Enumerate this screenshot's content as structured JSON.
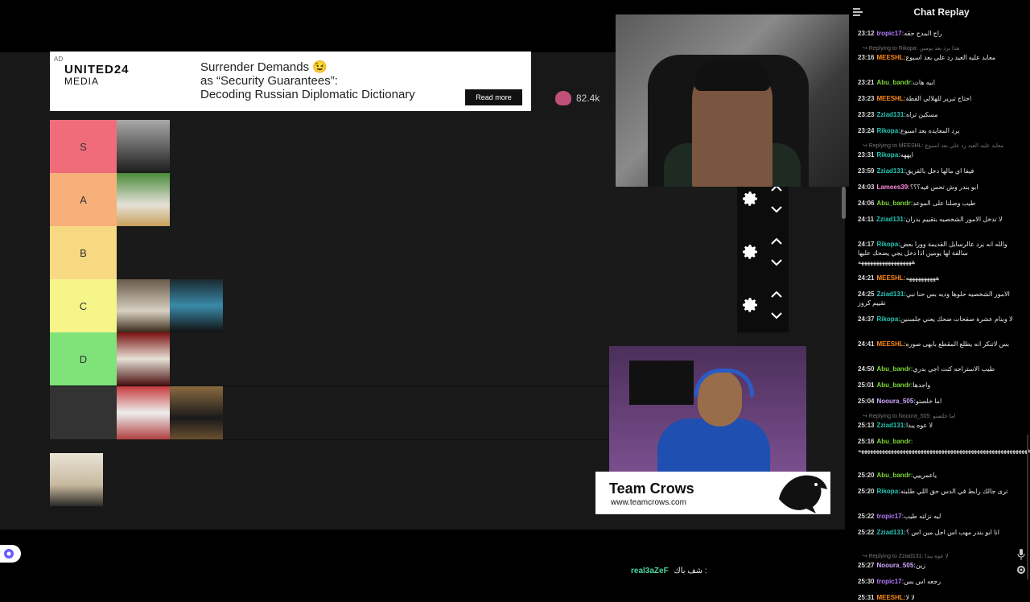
{
  "ad": {
    "tag": "AD",
    "brand_line1": "UNITED24",
    "brand_line2": "MEDIA",
    "headline_l1": "Surrender Demands 😉",
    "headline_l2": "as “Security Guarantees”:",
    "headline_l3": "Decoding Russian Diplomatic Dictionary",
    "cta": "Read more"
  },
  "views": "82.4k",
  "tiers": [
    {
      "label": "S",
      "color": "#f06c7b"
    },
    {
      "label": "A",
      "color": "#f8b07a"
    },
    {
      "label": "B",
      "color": "#f7d983"
    },
    {
      "label": "C",
      "color": "#f6f58a"
    },
    {
      "label": "D",
      "color": "#7fe37a"
    },
    {
      "label": "",
      "color": "#333333"
    }
  ],
  "streamer_banner": {
    "name": "Team Crows",
    "url": "www.teamcrows.com"
  },
  "bottom_chat": {
    "user": "real3aZeF",
    "text": "شف باك :"
  },
  "chat": {
    "title": "Chat Replay",
    "messages": [
      {
        "time": "23:12",
        "user": "tropic17",
        "color": "#b77bff",
        "text": "راح المدح حقه"
      },
      {
        "reply": "Replying to Rikopa: هذا يرد بعد يومين"
      },
      {
        "time": "23:16",
        "user": "MEESHL",
        "color": "#ff8a1a",
        "text": "معايد عليه العيد رد علي بعد اسبوع"
      },
      {
        "time": "23:21",
        "user": "Abu_bandr",
        "color": "#7cd63a",
        "text": "ابيه هات"
      },
      {
        "time": "23:23",
        "user": "MEESHL",
        "color": "#ff8a1a",
        "text": "احتاج تبرير للهلالي القطة"
      },
      {
        "time": "23:23",
        "user": "Zziad131",
        "color": "#27c7b8",
        "text": "مسكين تراه"
      },
      {
        "time": "23:24",
        "user": "Rikopa",
        "color": "#27c7b8",
        "text": "يرد المعايده بعد اسبوع"
      },
      {
        "reply": "Replying to MEESHL: معايد عليه العيد رد علي بعد اسبوع"
      },
      {
        "time": "23:31",
        "user": "Rikopa",
        "color": "#27c7b8",
        "text": "ايههه"
      },
      {
        "time": "23:59",
        "user": "Zziad131",
        "color": "#27c7b8",
        "text": "فيفا اي مالها دخل بالفريق"
      },
      {
        "time": "24:03",
        "user": "Lamees39",
        "color": "#ff8ad8",
        "text": "ابو بندر وش تحس فيه؟؟؟"
      },
      {
        "time": "24:06",
        "user": "Abu_bandr",
        "color": "#7cd63a",
        "text": "طيب وصلنا على الموعد"
      },
      {
        "time": "24:11",
        "user": "Zziad131",
        "color": "#27c7b8",
        "text": "لا تدخل الامور الشخصيه بتقييم بدران"
      },
      {
        "time": "24:17",
        "user": "Rikopa",
        "color": "#27c7b8",
        "text": "والله انه يرد عالرسايل القديمة وورا بعض سالفة لها يومين اذا دخل يجي يضحك عليها ههههههههههههههههههه"
      },
      {
        "time": "24:21",
        "user": "MEESHL",
        "color": "#ff8a1a",
        "text": "ههههههههههه"
      },
      {
        "time": "24:25",
        "user": "Zziad131",
        "color": "#27c7b8",
        "text": "الامور الشخصيه حلوها وديه بس حنا نبي تقييم كروز"
      },
      {
        "time": "24:37",
        "user": "Rikopa",
        "color": "#27c7b8",
        "text": "لا وبنام عشرة صفحات ضحك يعني جلسنين"
      },
      {
        "time": "24:41",
        "user": "MEESHL",
        "color": "#ff8a1a",
        "text": "بس لاتنكر انه يطلع المقطع بابهى صوره"
      },
      {
        "time": "24:50",
        "user": "Abu_bandr",
        "color": "#7cd63a",
        "text": "طيب الاستراحه كنت اجي بدري"
      },
      {
        "time": "25:01",
        "user": "Abu_bandr",
        "color": "#7cd63a",
        "text": "واجدها"
      },
      {
        "time": "25:04",
        "user": "Nooura_505",
        "color": "#d0a8ff",
        "text": "اما خلصتو"
      },
      {
        "reply": "Replying to Nooura_505: اما خلصتو"
      },
      {
        "time": "25:13",
        "user": "Zziad131",
        "color": "#27c7b8",
        "text": "لا عوه يبدا"
      },
      {
        "time": "25:16",
        "user": "Abu_bandr",
        "color": "#7cd63a",
        "text": "هههههههههههههههههههههههههههههههههههههههههههههههههههههههههه"
      },
      {
        "time": "25:20",
        "user": "Abu_bandr",
        "color": "#7cd63a",
        "text": "ياعمرييي"
      },
      {
        "time": "25:20",
        "user": "Rikopa",
        "color": "#27c7b8",
        "text": "ترى جالك رابط في الدس حق اللي طلبته"
      },
      {
        "time": "25:22",
        "user": "tropic17",
        "color": "#b77bff",
        "text": "ليه نزلته طيب"
      },
      {
        "time": "25:22",
        "user": "Zziad131",
        "color": "#27c7b8",
        "text": "انا ابو بندر مهب اس اجل مين اس ؟"
      },
      {
        "reply": "Replying to Zziad131: لا عوه يبدا"
      },
      {
        "time": "25:27",
        "user": "Nooura_505",
        "color": "#d0a8ff",
        "text": "زين"
      },
      {
        "time": "25:30",
        "user": "tropic17",
        "color": "#b77bff",
        "text": "رجعه اس بس"
      },
      {
        "time": "25:31",
        "user": "MEESHL",
        "color": "#ff8a1a",
        "text": "لا لا"
      }
    ]
  }
}
